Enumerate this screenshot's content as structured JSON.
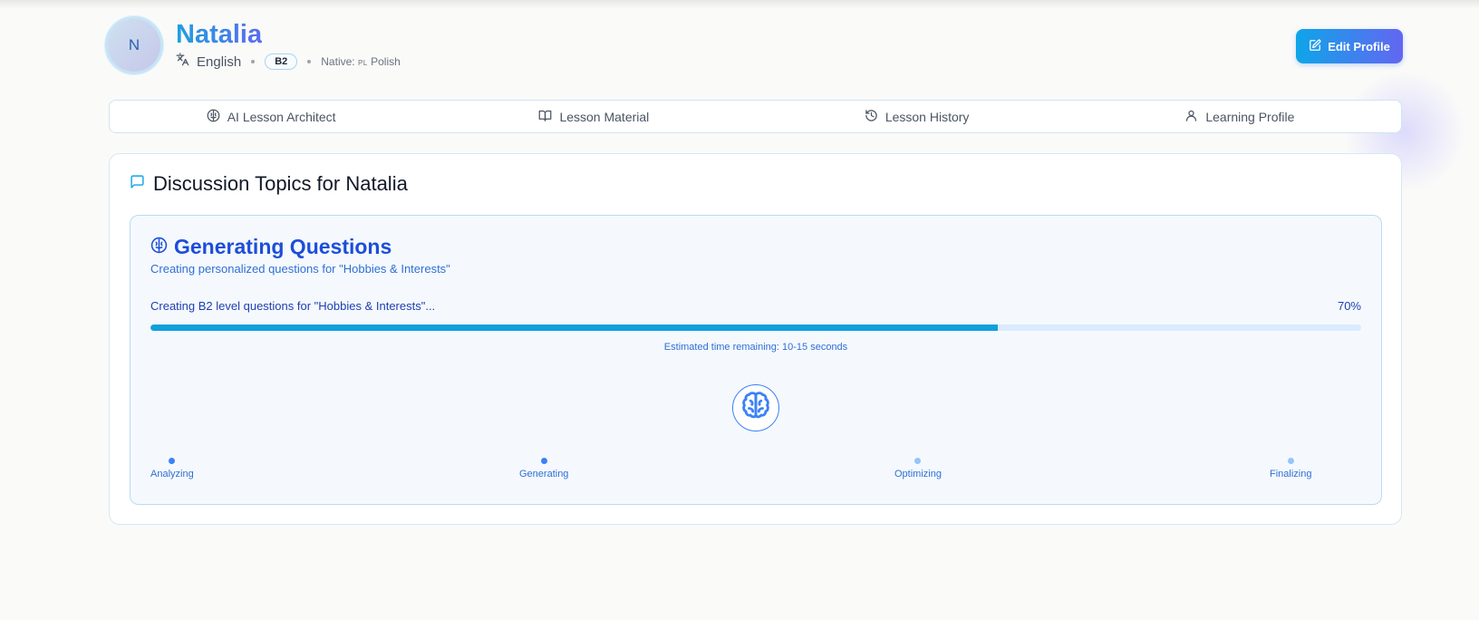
{
  "header": {
    "avatar_initial": "N",
    "student_name": "Natalia",
    "language": "English",
    "level": "B2",
    "native_label": "Native:",
    "native_flag": "PL",
    "native_language": "Polish",
    "edit_profile_label": "Edit Profile"
  },
  "tabs": [
    {
      "label": "AI Lesson Architect",
      "icon": "brain-icon"
    },
    {
      "label": "Lesson Material",
      "icon": "book-open-icon"
    },
    {
      "label": "Lesson History",
      "icon": "history-icon"
    },
    {
      "label": "Learning Profile",
      "icon": "user-icon"
    }
  ],
  "discussion": {
    "title": "Discussion Topics for Natalia",
    "icon": "message-square-icon"
  },
  "generation": {
    "title": "Generating Questions",
    "subtitle": "Creating personalized questions for \"Hobbies & Interests\"",
    "progress_label": "Creating B2 level questions for \"Hobbies & Interests\"...",
    "progress_percent_text": "70%",
    "progress_fraction": 0.7,
    "eta": "Estimated time remaining: 10-15 seconds",
    "steps": [
      {
        "label": "Analyzing",
        "state": "active"
      },
      {
        "label": "Generating",
        "state": "active"
      },
      {
        "label": "Optimizing",
        "state": "pending"
      },
      {
        "label": "Finalizing",
        "state": "pending"
      }
    ]
  },
  "colors": {
    "accent_start": "#0ea5e9",
    "accent_end": "#6366f1",
    "progress_fill": "#10a0db",
    "step_active": "#3b82f6",
    "step_pending": "#93c5fd"
  }
}
